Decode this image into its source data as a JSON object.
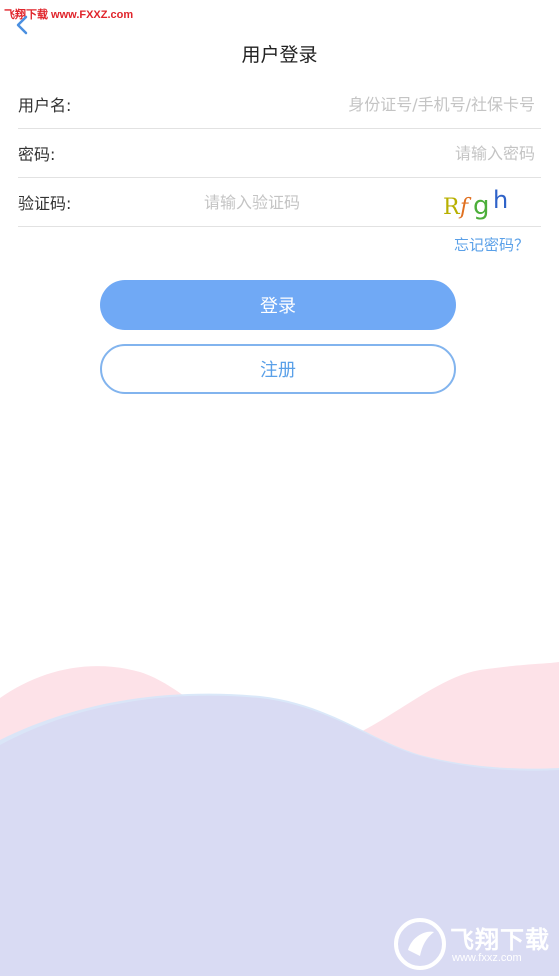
{
  "watermark_top": "飞翔下载 www.FXXZ.com",
  "header": {
    "title": "用户登录",
    "back_icon": "chevron-left-icon"
  },
  "form": {
    "username": {
      "label": "用户名:",
      "placeholder": "身份证号/手机号/社保卡号",
      "value": ""
    },
    "password": {
      "label": "密码:",
      "placeholder": "请输入密码",
      "value": ""
    },
    "captcha": {
      "label": "验证码:",
      "placeholder": "请输入验证码",
      "value": "",
      "image_text": "Rfgh"
    }
  },
  "forgot_password": "忘记密码？",
  "buttons": {
    "login": "登录",
    "register": "注册"
  },
  "logo_watermark": {
    "main": "飞翔下载",
    "sub": "www.fxxz.com"
  },
  "colors": {
    "accent": "#5aa0e8",
    "login_button": "#70a9f5",
    "wave_pink": "#fde0e6",
    "wave_blue": "#d4e4f8",
    "wave_lavender": "#d9dbf3"
  }
}
